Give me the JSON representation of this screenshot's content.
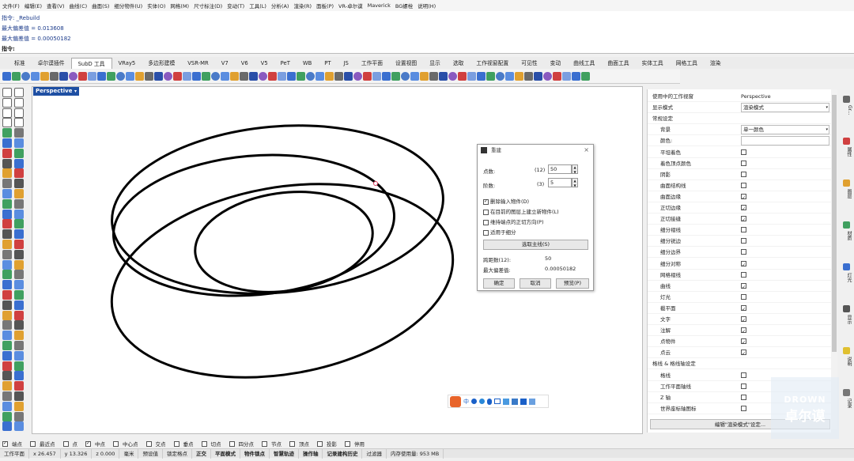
{
  "menu": [
    "文件(F)",
    "编辑(E)",
    "查看(V)",
    "曲线(C)",
    "曲面(S)",
    "细分物件(U)",
    "实体(O)",
    "网格(M)",
    "尺寸标注(D)",
    "变动(T)",
    "工具(L)",
    "分析(A)",
    "渲染(R)",
    "面板(P)",
    "VR-卓尔谟",
    "Maverick",
    "BG螺栓",
    "说明(H)"
  ],
  "command_history": [
    "指令: _Rebuild",
    "最大偏差值 = 0.013608",
    "最大偏差值 = 0.00050182"
  ],
  "command_prompt": "指令:",
  "tabs": [
    "标准",
    "卓尔谟插件",
    "SubD 工具",
    "VRay5",
    "多边形建模",
    "VSR-MR",
    "V7",
    "V6",
    "V5",
    "PeT",
    "WB",
    "PT",
    "JS",
    "工作平面",
    "设置视图",
    "显示",
    "选取",
    "工作视窗配置",
    "可见性",
    "变动",
    "曲线工具",
    "曲面工具",
    "实体工具",
    "网格工具",
    "渲染"
  ],
  "active_tab": "SubD 工具",
  "viewport": {
    "label": "Perspective"
  },
  "dialog": {
    "title": "重建",
    "point_count_label": "点数:",
    "point_count_current": "(12)",
    "point_count_value": "50",
    "degree_label": "阶数:",
    "degree_current": "(3)",
    "degree_value": "5",
    "options": [
      {
        "label": "删除输入物件(D)",
        "checked": true
      },
      {
        "label": "在目前的图层上建立新物件(L)",
        "checked": false
      },
      {
        "label": "维持端点的正切方向(P)",
        "checked": false
      },
      {
        "label": "适用于细分",
        "checked": false
      }
    ],
    "select_main_btn": "选取主线(S)",
    "span_label": "跨距数(12):",
    "span_value": "50",
    "max_dev_label": "最大偏差值:",
    "max_dev_value": "0.00050182",
    "ok": "确定",
    "cancel": "取消",
    "preview": "预览(P)"
  },
  "props": {
    "viewport_label": "使用中的工作视窗",
    "viewport_value": "Perspective",
    "display_mode_label": "显示模式",
    "display_mode_value": "渲染模式",
    "general_section": "常规设定",
    "background_label": "背景",
    "background_value": "单一颜色",
    "color_label": "颜色:",
    "checks": [
      {
        "label": "平坦着色",
        "checked": false
      },
      {
        "label": "着色顶点颜色",
        "checked": false
      },
      {
        "label": "阴影",
        "checked": false
      },
      {
        "label": "曲面结构线",
        "checked": false
      },
      {
        "label": "曲面边缘",
        "checked": true
      },
      {
        "label": "正切边缘",
        "checked": true
      },
      {
        "label": "正切接缝",
        "checked": true
      },
      {
        "label": "细分褶线",
        "checked": false
      },
      {
        "label": "细分锐边",
        "checked": false
      },
      {
        "label": "细分边界",
        "checked": false
      },
      {
        "label": "细分对称",
        "checked": true
      },
      {
        "label": "网格褶线",
        "checked": false
      },
      {
        "label": "曲线",
        "checked": true
      },
      {
        "label": "灯光",
        "checked": false
      },
      {
        "label": "截平面",
        "checked": true
      },
      {
        "label": "文字",
        "checked": true
      },
      {
        "label": "注解",
        "checked": true
      },
      {
        "label": "点物件",
        "checked": true
      },
      {
        "label": "点云",
        "checked": true
      }
    ],
    "grid_section": "格线 & 格线轴设定",
    "grid_checks": [
      {
        "label": "格线",
        "checked": false
      },
      {
        "label": "工作平面轴线",
        "checked": false
      },
      {
        "label": "Z 轴",
        "checked": false
      },
      {
        "label": "世界座标轴图标",
        "checked": false
      }
    ],
    "edit_btn": "编辑\"渲染模式\"设定..."
  },
  "right_tabs": [
    "Gr...",
    "属性",
    "图层",
    "材质",
    "灯光",
    "显示",
    "说明",
    "记录"
  ],
  "snaps": [
    {
      "label": "端点",
      "checked": true
    },
    {
      "label": "最近点",
      "checked": false
    },
    {
      "label": "点",
      "checked": false
    },
    {
      "label": "中点",
      "checked": true
    },
    {
      "label": "中心点",
      "checked": false
    },
    {
      "label": "交点",
      "checked": false
    },
    {
      "label": "垂点",
      "checked": false
    },
    {
      "label": "切点",
      "checked": false
    },
    {
      "label": "四分点",
      "checked": false
    },
    {
      "label": "节点",
      "checked": false
    },
    {
      "label": "顶点",
      "checked": false
    },
    {
      "label": "投影",
      "checked": false
    },
    {
      "label": "停用",
      "checked": false
    }
  ],
  "status": [
    "工作平面",
    "x 26.457",
    "y 13.326",
    "z 0.000",
    "毫米",
    "预设值",
    "锁定格点",
    "正交",
    "平面模式",
    "物件锁点",
    "智慧轨迹",
    "操作轴",
    "记录建构历史",
    "过滤器",
    "内存使用量: 953 MB"
  ],
  "watermark": {
    "line1": "DROWN",
    "line2": "卓尔谟"
  }
}
